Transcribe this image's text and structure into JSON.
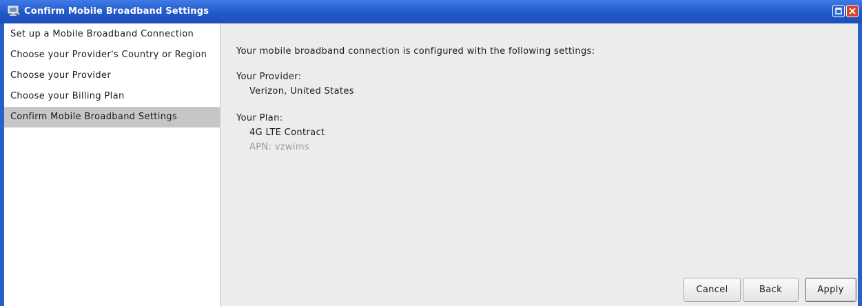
{
  "window": {
    "title": "Confirm Mobile Broadband Settings",
    "title_icon": "network-icon",
    "accent_color": "#2a5fc8"
  },
  "sidebar": {
    "steps": [
      {
        "label": "Set up a Mobile Broadband Connection",
        "active": false
      },
      {
        "label": "Choose your Provider's Country or Region",
        "active": false
      },
      {
        "label": "Choose your Provider",
        "active": false
      },
      {
        "label": "Choose your Billing Plan",
        "active": false
      },
      {
        "label": "Confirm Mobile Broadband Settings",
        "active": true
      }
    ]
  },
  "main": {
    "intro": "Your mobile broadband connection is configured with the following settings:",
    "provider_label": "Your Provider:",
    "provider_value": "Verizon, United States",
    "plan_label": "Your Plan:",
    "plan_value": "4G LTE Contract",
    "apn": "APN: vzwims"
  },
  "buttons": {
    "cancel": "Cancel",
    "back": "Back",
    "apply": "Apply"
  }
}
